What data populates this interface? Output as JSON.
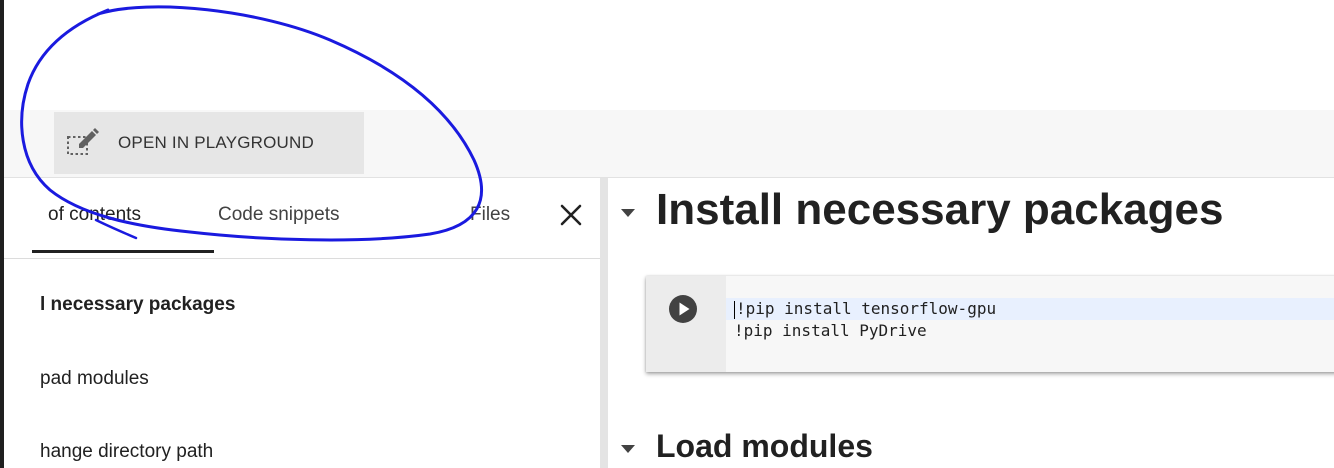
{
  "toolbar": {
    "open_in_playground_label": "OPEN IN PLAYGROUND",
    "open_in_playground_icon": "edit-in-playground-icon"
  },
  "sidebar": {
    "tabs": [
      {
        "label": "of contents",
        "active": true
      },
      {
        "label": "Code snippets",
        "active": false
      },
      {
        "label": "Files",
        "active": false
      }
    ],
    "close_icon": "close-icon",
    "toc_items": [
      {
        "label": "l necessary packages",
        "bold": true
      },
      {
        "label": "pad modules",
        "bold": false
      },
      {
        "label": "hange directory path",
        "bold": false
      }
    ]
  },
  "main": {
    "sections": [
      {
        "title": "Install necessary packages",
        "caret_icon": "collapse-caret-icon"
      },
      {
        "title": "Load modules",
        "caret_icon": "collapse-caret-icon"
      }
    ],
    "code_cell": {
      "run_icon": "play-icon",
      "lines": [
        "!pip install tensorflow-gpu",
        "!pip install PyDrive"
      ]
    }
  },
  "annotation": {
    "type": "freehand-circle",
    "color": "#1a1adf"
  },
  "colors": {
    "active_tab_underline": "#212121",
    "current_line_highlight": "#e8f0fe",
    "toolbar_bg": "#f7f7f7",
    "button_bg": "#e6e6e6"
  }
}
